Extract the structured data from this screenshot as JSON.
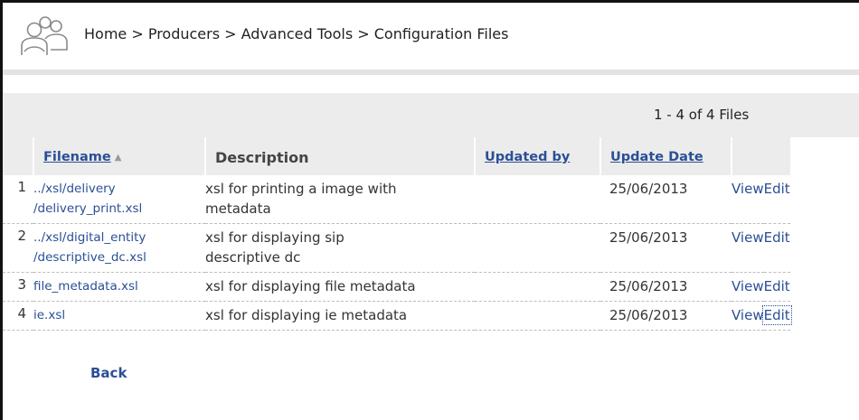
{
  "breadcrumb": "Home > Producers > Advanced Tools > Configuration Files",
  "paging_text": "1 - 4 of 4 Files",
  "columns": {
    "filename": "Filename",
    "description": "Description",
    "updated_by": "Updated by",
    "update_date": "Update Date"
  },
  "rows": [
    {
      "index": "1",
      "filename_line1": "../xsl/delivery",
      "filename_line2": "/delivery_print.xsl",
      "description_line1": "xsl for printing a image with",
      "description_line2": "metadata",
      "updated_by": "",
      "update_date": "25/06/2013",
      "view": "View",
      "edit": "Edit"
    },
    {
      "index": "2",
      "filename_line1": "../xsl/digital_entity",
      "filename_line2": "/descriptive_dc.xsl",
      "description_line1": "xsl for displaying sip",
      "description_line2": "descriptive dc",
      "updated_by": "",
      "update_date": "25/06/2013",
      "view": "View",
      "edit": "Edit"
    },
    {
      "index": "3",
      "filename_line1": "file_metadata.xsl",
      "filename_line2": "",
      "description_line1": "xsl for displaying file metadata",
      "description_line2": "",
      "updated_by": "",
      "update_date": "25/06/2013",
      "view": "View",
      "edit": "Edit"
    },
    {
      "index": "4",
      "filename_line1": "ie.xsl",
      "filename_line2": "",
      "description_line1": "xsl for displaying ie metadata",
      "description_line2": "",
      "updated_by": "",
      "update_date": "25/06/2013",
      "view": "View",
      "edit": "Edit"
    }
  ],
  "back_label": "Back",
  "icons": {
    "logo": "users-icon",
    "sort": "sort-ascending-icon"
  },
  "colors": {
    "link": "#2a4f95",
    "header_bg": "#ececec"
  }
}
